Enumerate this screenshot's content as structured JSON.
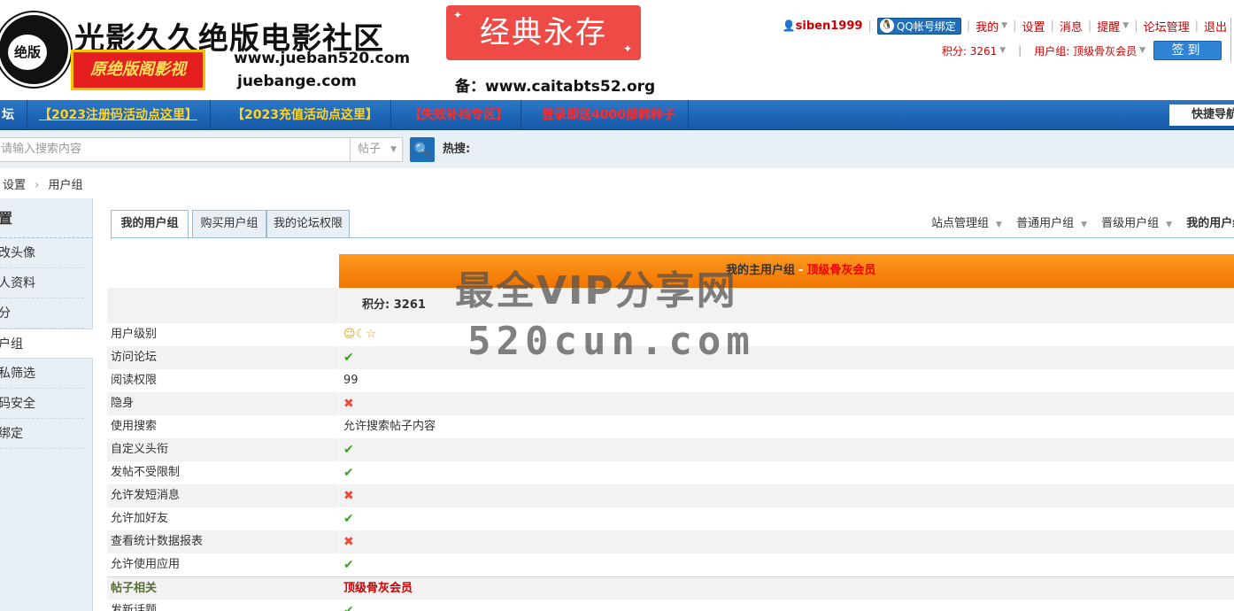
{
  "header": {
    "logo_text": "绝版",
    "site_title": "光影久久绝版电影社区",
    "slogan": "原绝版阁影视",
    "domain_1": "www.jueban520.com",
    "domain_2": "juebange.com",
    "motto": "经典永存",
    "backup_domain": "备：www.caitabts52.org"
  },
  "userbar": {
    "username": "siben1999",
    "qq_bind": "QQ帐号绑定",
    "mine": "我的",
    "settings": "设置",
    "messages": "消息",
    "reminders": "提醒",
    "forum_admin": "论坛管理",
    "logout": "退出",
    "points": "积分: 3261",
    "usergroup": "用户组: 顶级骨灰会员",
    "checkin": "签到"
  },
  "nav": {
    "first": "坛",
    "items": [
      "【2023注册码活动点这里】",
      "【2023充值活动点这里】",
      "【失效补档专区】",
      "登录即送4000部韩种子"
    ],
    "quick_nav": "快捷导航"
  },
  "search": {
    "placeholder": "请输入搜索内容",
    "type": "帖子",
    "hot_label": "热搜:"
  },
  "breadcrumb": {
    "items": [
      "设置",
      "用户组"
    ]
  },
  "sidebar": {
    "title": "置",
    "items": [
      "改头像",
      "人资料",
      "分",
      "户组",
      "私筛选",
      "码安全",
      "绑定"
    ],
    "active_index": 3
  },
  "tabs": [
    "我的用户组",
    "购买用户组",
    "我的论坛权限"
  ],
  "group_nav": {
    "items": [
      "站点管理组",
      "普通用户组",
      "晋级用户组",
      "我的用户组"
    ]
  },
  "permissions": {
    "header_label": "我的主用户组",
    "header_group": "顶级骨灰会员",
    "score_label": "积分: 3261",
    "rows": [
      {
        "label": "用户级别",
        "value": "stars"
      },
      {
        "label": "访问论坛",
        "value": "yes"
      },
      {
        "label": "阅读权限",
        "value": "99"
      },
      {
        "label": "隐身",
        "value": "no"
      },
      {
        "label": "使用搜索",
        "value": "允许搜索帖子内容"
      },
      {
        "label": "自定义头衔",
        "value": "yes"
      },
      {
        "label": "发帖不受限制",
        "value": "yes"
      },
      {
        "label": "允许发短消息",
        "value": "no"
      },
      {
        "label": "允许加好友",
        "value": "yes"
      },
      {
        "label": "查看统计数据报表",
        "value": "no"
      },
      {
        "label": "允许使用应用",
        "value": "yes"
      }
    ],
    "section_label": "帖子相关",
    "section_value": "顶级骨灰会员",
    "next_row_label": "发新话题"
  },
  "watermark": {
    "line1": "最全VIP分享网",
    "line2": "520cun.com"
  },
  "icons": {
    "yes": "✔",
    "no": "✖",
    "stars": [
      "☺",
      "☾",
      "☆"
    ]
  },
  "colors": {
    "nav_bg": "#1f6fb8",
    "accent_red": "#cc0000",
    "header_orange": "#f07400"
  }
}
